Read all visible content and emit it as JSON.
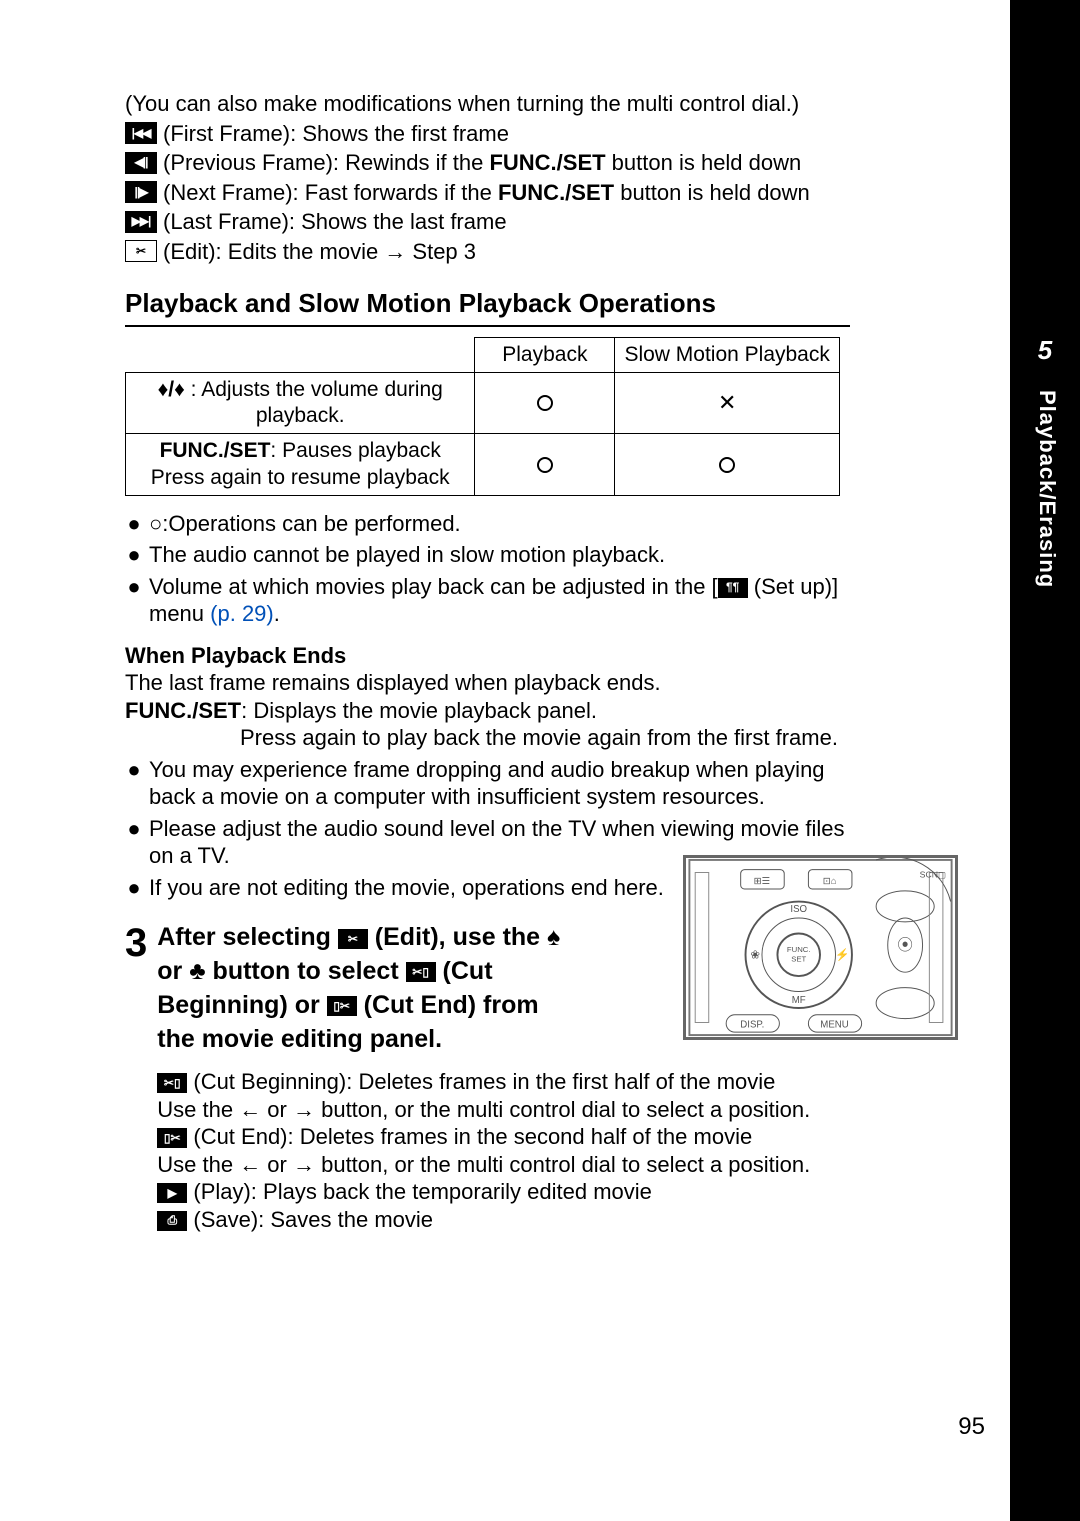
{
  "side": {
    "chapter_num": "5",
    "chapter_label": "Playback/Erasing"
  },
  "intro": "(You can also make modifications when turning the multi control dial.)",
  "frame_icons": [
    {
      "icon": "first-frame-icon",
      "glyph": "|◀◀",
      "label": " (First Frame): Shows the first frame"
    },
    {
      "icon": "previous-frame-icon",
      "glyph": "◀||",
      "label_pre": " (Previous Frame): Rewinds if the ",
      "bold": "FUNC./SET",
      "label_post": " button is held down"
    },
    {
      "icon": "next-frame-icon",
      "glyph": "||▶",
      "label_pre": " (Next Frame): Fast forwards if the ",
      "bold": "FUNC./SET",
      "label_post": " button is held down"
    },
    {
      "icon": "last-frame-icon",
      "glyph": "▶▶|",
      "label": " (Last Frame): Shows the last frame"
    },
    {
      "icon": "edit-icon",
      "glyph": "✂",
      "label": " (Edit): Edits the movie → Step 3"
    }
  ],
  "section_heading": "Playback and Slow Motion Playback Operations",
  "table": {
    "head": [
      "",
      "Playback",
      "Slow Motion Playback"
    ],
    "rows": [
      {
        "label_pre": "",
        "arrows": "♠/♣",
        "label": " : Adjusts the volume during playback.",
        "c1": "○",
        "c2": "✕"
      },
      {
        "bold": "FUNC./SET",
        "label": ": Pauses playback Press again to resume playback",
        "c1": "○",
        "c2": "○"
      }
    ]
  },
  "below_table": [
    "○:Operations can be performed.",
    "The audio cannot be played in slow motion playback."
  ],
  "volume_line": {
    "pre": "Volume at which movies play back can be adjusted in the [",
    "icon_glyph": "¶¶",
    "post": " (Set up)] menu ",
    "xref": "(p. 29)",
    "tail": "."
  },
  "when_ends_h": "When Playback Ends",
  "when_ends_line": "The last frame remains displayed when playback ends.",
  "funcset_line": {
    "bold": "FUNC./SET",
    "text": ": Displays the movie playback panel."
  },
  "funcset_sub": "Press again to play back the movie again from the first frame.",
  "tips": [
    "You may experience frame dropping and audio breakup when playing back a movie on a computer with insufficient system resources.",
    "Please adjust the audio sound level on the TV when viewing movie files on a TV.",
    "If you are not editing the movie, operations end here."
  ],
  "step3": {
    "num": "3",
    "title_parts": {
      "p1": "After selecting ",
      "p2": " (Edit), use the ",
      "p3": " or ",
      "p4": " button to select ",
      "p5": " (Cut Beginning) or ",
      "p6": " (Cut End) from the movie editing panel."
    },
    "after": [
      {
        "icon": "cut-beginning-icon",
        "glyph": "✂▯",
        "text": " (Cut Beginning): Deletes frames in the first half of the movie"
      },
      {
        "plain_pre": "Use the ",
        "arrow1": "←",
        "mid": " or ",
        "arrow2": "→",
        "plain_post": " button, or the multi control dial to select a position."
      },
      {
        "icon": "cut-end-icon",
        "glyph": "▯✂",
        "text": " (Cut End): Deletes frames in the second half of the movie"
      },
      {
        "plain_pre": "Use the ",
        "arrow1": "←",
        "arrow2": "→",
        "mid": " or ",
        "plain_post": " button, or the multi control dial to select a position."
      },
      {
        "icon": "play-icon",
        "glyph": "▶",
        "text": " (Play): Plays back the temporarily edited movie"
      },
      {
        "icon": "save-icon",
        "glyph": "⎙",
        "text": " (Save): Saves the movie"
      }
    ]
  },
  "pagenum": "95",
  "camera_labels": {
    "top1": "⊞☰",
    "top2": "⊡⌂",
    "iso": "ISO",
    "func": "FUNC.\nSET",
    "mf": "MF",
    "disp": "DISP.",
    "menu": "MENU"
  }
}
